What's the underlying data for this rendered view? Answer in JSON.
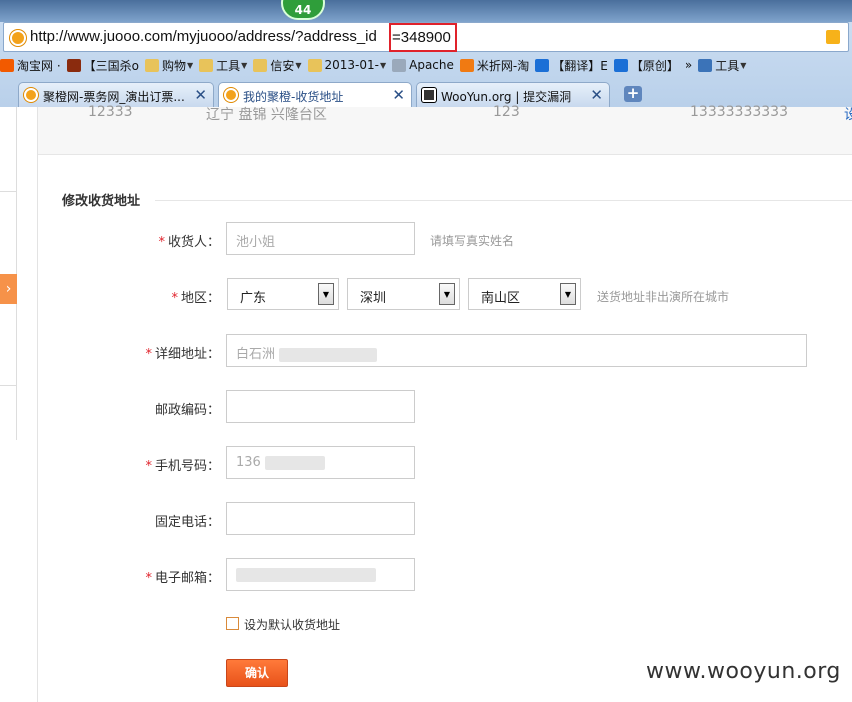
{
  "browser": {
    "badge": "44",
    "url": "http://www.juooo.com/myjuooo/address/?address_id",
    "url_id": "=348900",
    "bookmarks": [
      {
        "label": "淘宝网 ·",
        "icon": "taobao-icon",
        "color": "#f25a00"
      },
      {
        "label": "【三国杀o",
        "icon": "sanguosha-icon",
        "color": "#8a2b0e"
      },
      {
        "label": "购物",
        "icon": "folder-icon",
        "color": "#e8c35a",
        "menu": true
      },
      {
        "label": "工具",
        "icon": "folder-icon",
        "color": "#e8c35a",
        "menu": true
      },
      {
        "label": "信安",
        "icon": "folder-icon",
        "color": "#e8c35a",
        "menu": true
      },
      {
        "label": "2013-01-",
        "icon": "folder-icon",
        "color": "#e8c35a",
        "menu": true
      },
      {
        "label": "Apache",
        "icon": "page-icon",
        "color": "#9aa9bb"
      },
      {
        "label": "米折网-淘",
        "icon": "mizhe-icon",
        "color": "#f07a12"
      },
      {
        "label": "【翻译】E",
        "icon": "snowflake-icon",
        "color": "#1b6fd6"
      },
      {
        "label": "【原创】",
        "icon": "snowflake-icon",
        "color": "#1b6fd6"
      },
      {
        "label": "»",
        "icon": "",
        "color": ""
      },
      {
        "label": "工具",
        "icon": "toolbox-icon",
        "color": "#3b73b8",
        "menu": true
      }
    ],
    "tabs": [
      {
        "label": "聚橙网-票务网_演出订票...",
        "active": false
      },
      {
        "label": "我的聚橙-收货地址",
        "active": true
      },
      {
        "label": "WooYun.org | 提交漏洞",
        "active": false
      }
    ]
  },
  "previous_address": {
    "postcode": "12333",
    "region": "辽宁 盘锦 兴隆台区",
    "detail": "123",
    "phone": "13333333333",
    "action": "设"
  },
  "form": {
    "title": "修改收货地址",
    "required_mark": "*",
    "receiver": {
      "label": "收货人：",
      "value": "池小姐",
      "hint": "请填写真实姓名"
    },
    "region": {
      "label": "地区：",
      "province": "广东",
      "city": "深圳",
      "district": "南山区",
      "hint": "送货地址非出演所在城市"
    },
    "detail": {
      "label": "详细地址：",
      "value": "白石洲"
    },
    "postcode": {
      "label": "邮政编码：",
      "value": ""
    },
    "mobile": {
      "label": "手机号码：",
      "value": "136"
    },
    "landline": {
      "label": "固定电话：",
      "value": ""
    },
    "email": {
      "label": "电子邮箱：",
      "value": ""
    },
    "default_checkbox": {
      "label": "设为默认收货地址",
      "checked": false
    },
    "confirm_label": "确认"
  },
  "watermark": "www.wooyun.org",
  "colors": {
    "accent": "#f0612a",
    "required": "#e0222b",
    "highlight_box": "#e0222b"
  }
}
